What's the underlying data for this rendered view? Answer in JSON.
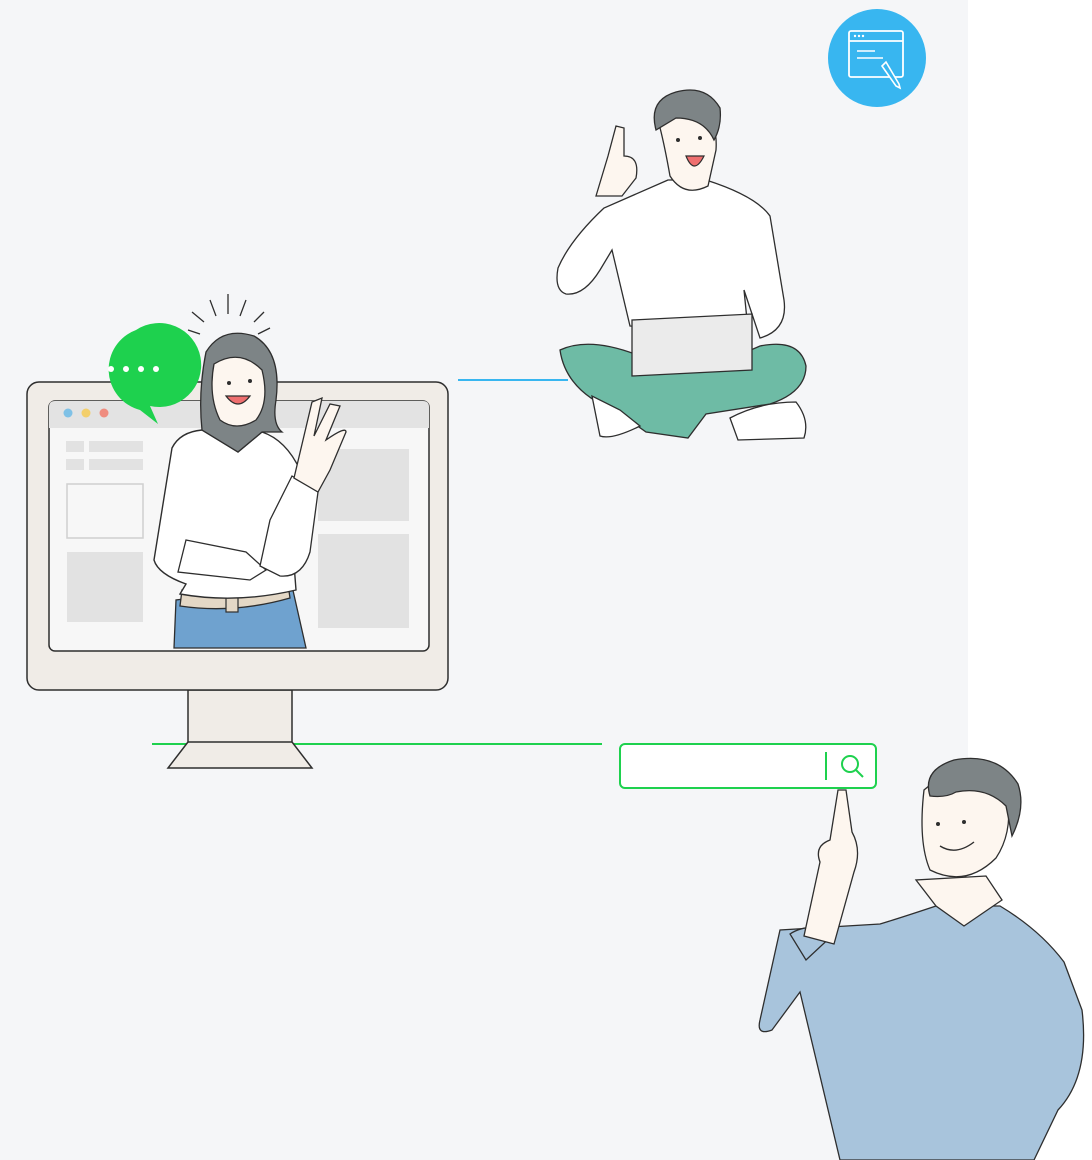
{
  "colors": {
    "panel_bg": "#f5f6f8",
    "accent_green": "#1ed14e",
    "accent_blue": "#38b6f0",
    "pants_green": "#6ebba5",
    "shirt_blue": "#a8c4dc",
    "jeans_blue": "#6fa2cf",
    "hair_gray": "#7d8486",
    "monitor_frame": "#f0ece7",
    "outline": "#2e2e2e"
  },
  "icons": {
    "chat_bubble": "chat-dots-icon",
    "editor_badge": "document-edit-icon",
    "search": "search-icon"
  },
  "search_bar": {
    "value": "",
    "placeholder": ""
  }
}
